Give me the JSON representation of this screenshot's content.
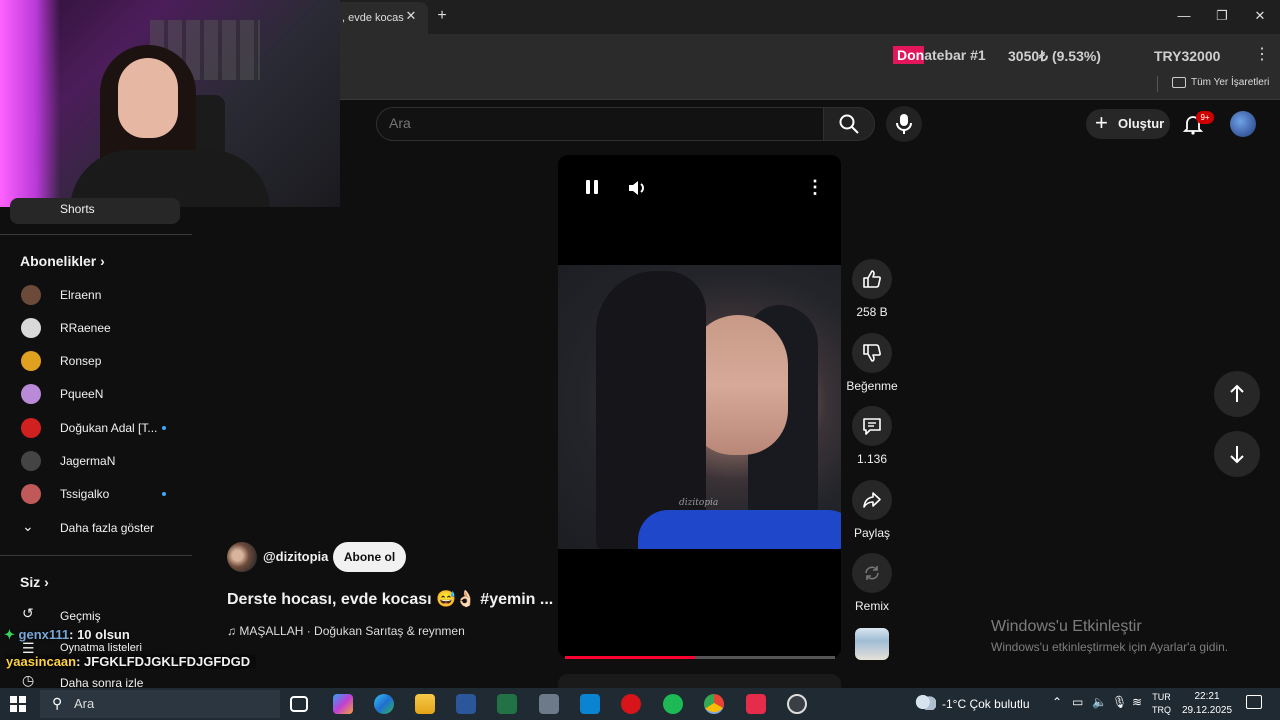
{
  "browser": {
    "tab_title": ", evde kocas",
    "tab_close": "✕",
    "new_tab": "+",
    "donatebar_prefix": "Don",
    "donatebar_rest": "atebar #1",
    "donate_amount": "3050₺ (9.53%)",
    "donate_goal": "TRY32000",
    "bookmarks_label": "Tüm Yer İşaretleri"
  },
  "youtube_header": {
    "search_placeholder": "Ara",
    "create_label": "Oluştur",
    "notification_count": "9+"
  },
  "sidebar": {
    "shorts_label": "Shorts",
    "subscriptions_title": "Abonelikler",
    "subscriptions": [
      {
        "name": "Elraenn",
        "live": false,
        "color": "#6b4a3a"
      },
      {
        "name": "RRaenee",
        "live": false,
        "color": "#d9d9d9"
      },
      {
        "name": "Ronsep",
        "live": false,
        "color": "#e0a020"
      },
      {
        "name": "PqueeN",
        "live": false,
        "color": "#b98ad8"
      },
      {
        "name": "Doğukan Adal [T...",
        "live": true,
        "color": "#d02020"
      },
      {
        "name": "JagermaN",
        "live": false,
        "color": "#444444"
      },
      {
        "name": "Tssigalko",
        "live": true,
        "color": "#c05a5a"
      }
    ],
    "show_more": "Daha fazla göster",
    "you_title": "Siz",
    "history": "Geçmiş",
    "playlists": "Oynatma listeleri",
    "watch_later": "Daha sonra izle"
  },
  "short": {
    "watermark": "dizitopia",
    "channel_handle": "@dizitopia",
    "subscribe_label": "Abone ol",
    "title": "Derste hocası, evde kocası 😅👌🏻 #yemin ...",
    "music": "♫ MAŞALLAH · Doğukan Sarıtaş & reynmen",
    "progress_fraction": 0.48,
    "likes": "258 B",
    "dislike_label": "Beğenme",
    "comments": "1.136",
    "share_label": "Paylaş",
    "remix_label": "Remix"
  },
  "chat": [
    {
      "user": "genx111",
      "message": ": 10 olsun"
    },
    {
      "user": "yaasincaan",
      "message": ": JFGKLFDJGKLFDJGFDGD"
    }
  ],
  "windows": {
    "activate_title": "Windows'u Etkinleştir",
    "activate_sub": "Windows'u etkinleştirmek için Ayarlar'a gidin.",
    "taskbar_search": "Ara",
    "weather": "-1°C  Çok bulutlu",
    "lang_top": "TUR",
    "lang_bottom": "TRQ",
    "time": "22:21",
    "date": "29.12.2025"
  }
}
